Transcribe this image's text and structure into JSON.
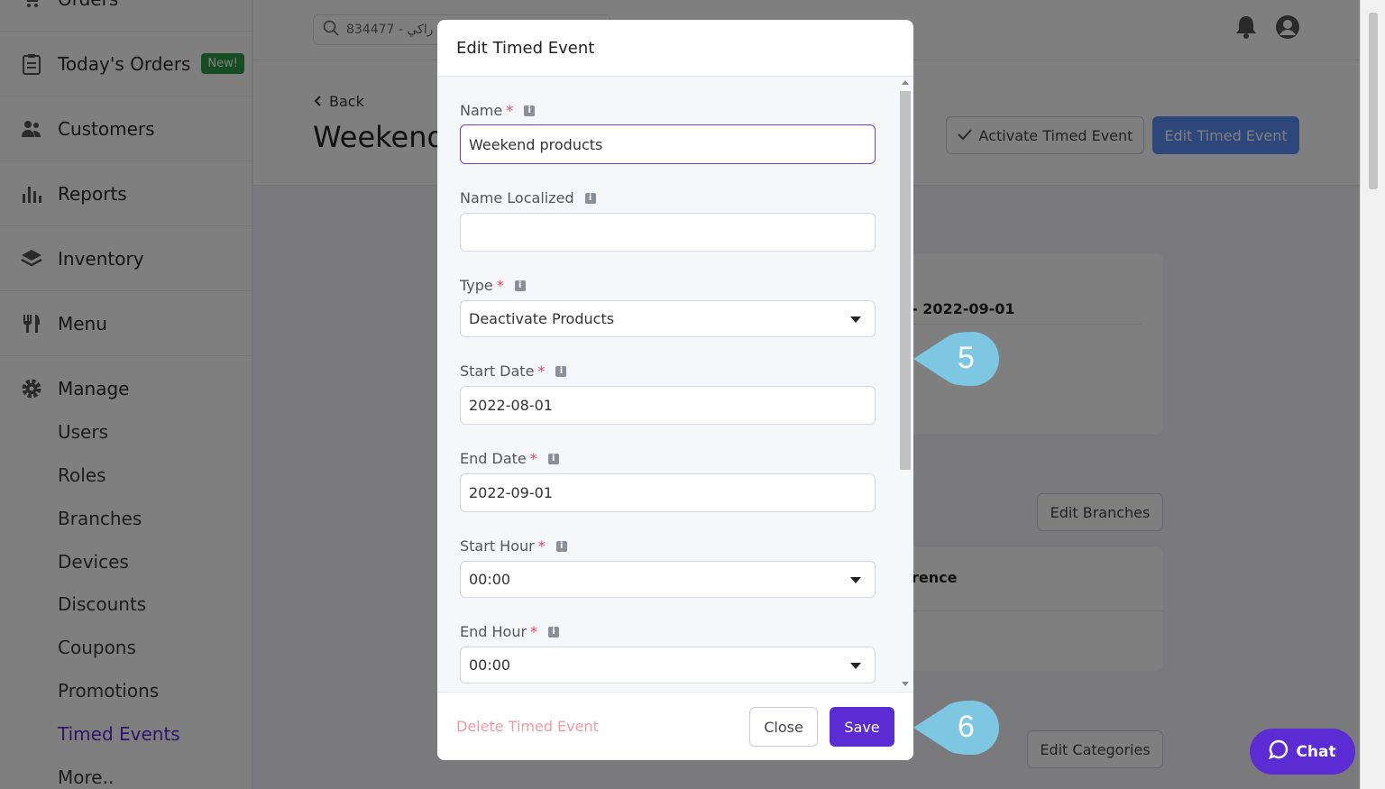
{
  "sidebar": {
    "orders_label": "Orders",
    "todays_orders_label": "Today's Orders",
    "new_badge": "New!",
    "customers_label": "Customers",
    "reports_label": "Reports",
    "inventory_label": "Inventory",
    "menu_label": "Menu",
    "manage_label": "Manage",
    "manage_items": [
      "Users",
      "Roles",
      "Branches",
      "Devices",
      "Discounts",
      "Coupons",
      "Promotions",
      "Timed Events",
      "More.."
    ]
  },
  "topbar": {
    "search_value": "834477 - راكي"
  },
  "page": {
    "back_label": "Back",
    "title": "Weekend",
    "activate_label": "Activate Timed Event",
    "edit_label": "Edit Timed Event",
    "card_date_text": "- 2022-09-01",
    "edit_branches_label": "Edit Branches",
    "reference_text": "rence",
    "edit_categories_label": "Edit Categories"
  },
  "modal": {
    "title": "Edit Timed Event",
    "fields": {
      "name_label": "Name",
      "name_value": "Weekend products",
      "name_localized_label": "Name Localized",
      "name_localized_value": "",
      "type_label": "Type",
      "type_value": "Deactivate Products",
      "start_date_label": "Start Date",
      "start_date_value": "2022-08-01",
      "end_date_label": "End Date",
      "end_date_value": "2022-09-01",
      "start_hour_label": "Start Hour",
      "start_hour_value": "00:00",
      "end_hour_label": "End Hour",
      "end_hour_value": "00:00"
    },
    "required_mark": "*",
    "info_mark": "i",
    "delete_label": "Delete Timed Event",
    "close_label": "Close",
    "save_label": "Save"
  },
  "callouts": {
    "step5": "5",
    "step6": "6"
  },
  "chat": {
    "label": "Chat"
  },
  "colors": {
    "primary": "#5b2bd3",
    "blue_button": "#5a8ef5",
    "callout": "#7ec7e3",
    "delete": "#f29aa3",
    "badge_green": "#2f9a45"
  }
}
